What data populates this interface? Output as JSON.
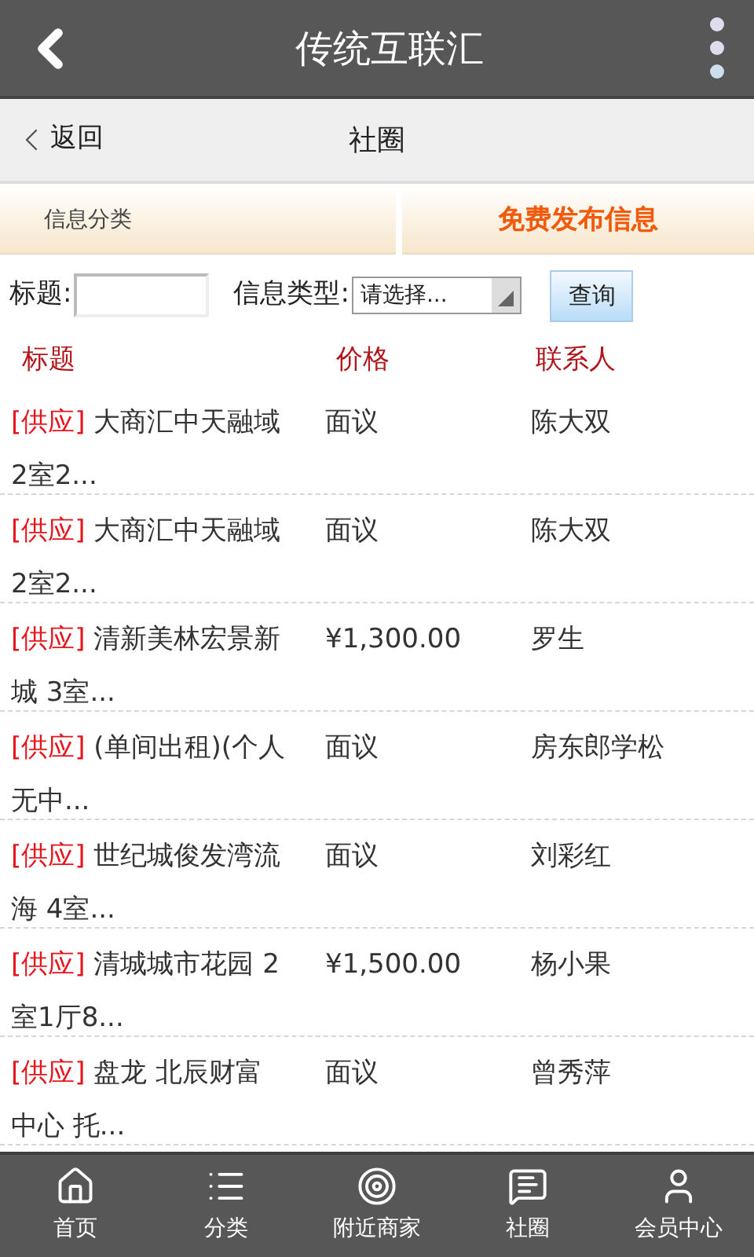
{
  "app_bar": {
    "title": "传统互联汇"
  },
  "sub_header": {
    "back": "返回",
    "title": "社圈"
  },
  "tabs": [
    {
      "label": "信息分类",
      "selected": false
    },
    {
      "label": "免费发布信息",
      "selected": true
    }
  ],
  "search": {
    "title_label": "标题:",
    "type_label": "信息类型:",
    "type_value": "请选择...",
    "button": "查询"
  },
  "table": {
    "columns": [
      "标题",
      "价格",
      "联系人"
    ],
    "rows": [
      {
        "tag": "[供应]",
        "title": "大商汇中天融域 2室2...",
        "price": "面议",
        "contact": "陈大双"
      },
      {
        "tag": "[供应]",
        "title": "大商汇中天融域 2室2...",
        "price": "面议",
        "contact": "陈大双"
      },
      {
        "tag": "[供应]",
        "title": "清新美林宏景新城 3室...",
        "price": "¥1,300.00",
        "contact": "罗生"
      },
      {
        "tag": "[供应]",
        "title": "(单间出租)(个人无中...",
        "price": "面议",
        "contact": "房东郎学松"
      },
      {
        "tag": "[供应]",
        "title": "世纪城俊发湾流海 4室...",
        "price": "面议",
        "contact": "刘彩红"
      },
      {
        "tag": "[供应]",
        "title": "清城城市花园 2室1厅8...",
        "price": "¥1,500.00",
        "contact": "杨小果"
      },
      {
        "tag": "[供应]",
        "title": "盘龙 北辰财富中心 托...",
        "price": "面议",
        "contact": "曾秀萍"
      }
    ]
  },
  "bottom_nav": [
    {
      "kind": "home",
      "label": "首页"
    },
    {
      "kind": "list",
      "label": "分类"
    },
    {
      "kind": "target",
      "label": "附近商家"
    },
    {
      "kind": "message",
      "label": "社圈"
    },
    {
      "kind": "user",
      "label": "会员中心"
    }
  ]
}
